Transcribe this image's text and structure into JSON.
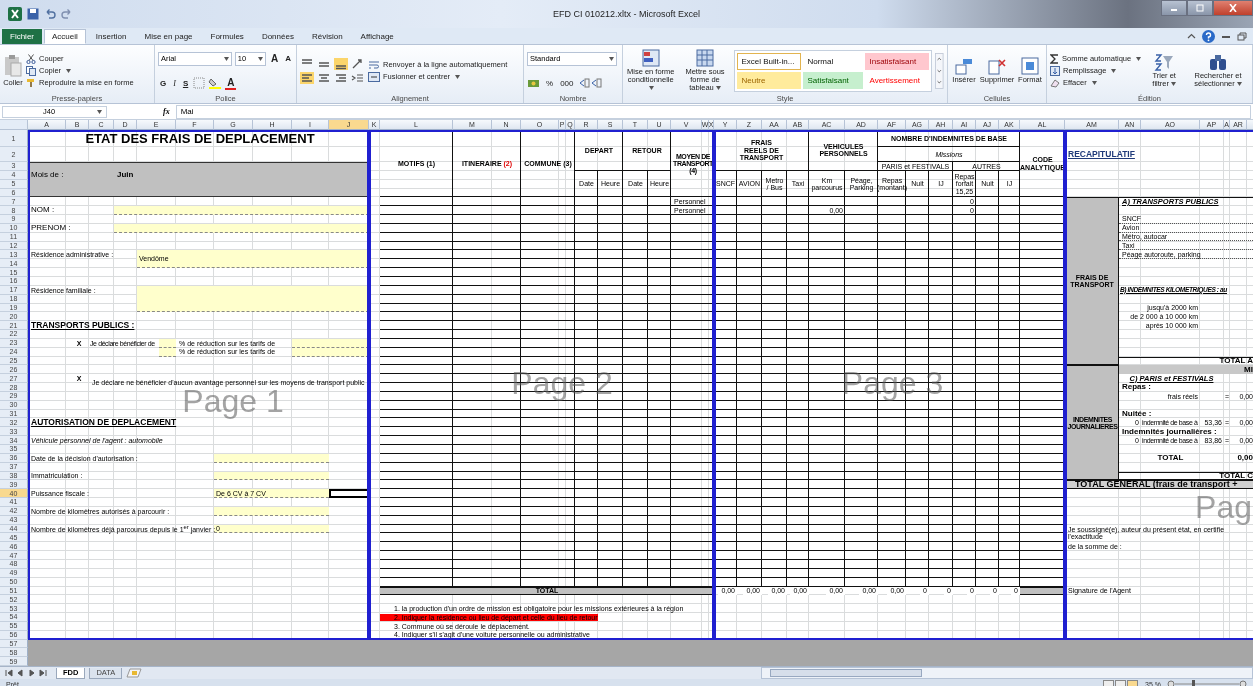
{
  "window": {
    "title": "EFD CI 010212.xltx - Microsoft Excel"
  },
  "tabs": [
    {
      "label": "Fichier",
      "kind": "file",
      "selected": false
    },
    {
      "label": "Accueil",
      "kind": "tab",
      "selected": true
    },
    {
      "label": "Insertion",
      "kind": "tab",
      "selected": false
    },
    {
      "label": "Mise en page",
      "kind": "tab",
      "selected": false
    },
    {
      "label": "Formules",
      "kind": "tab",
      "selected": false
    },
    {
      "label": "Données",
      "kind": "tab",
      "selected": false
    },
    {
      "label": "Révision",
      "kind": "tab",
      "selected": false
    },
    {
      "label": "Affichage",
      "kind": "tab",
      "selected": false
    }
  ],
  "clipboard": {
    "paste": "Coller",
    "cut": "Couper",
    "copy": "Copier",
    "format_painter": "Reproduire la mise en forme",
    "label": "Presse-papiers"
  },
  "font": {
    "family": "Arial",
    "size": "10",
    "grow": "A",
    "shrink": "A",
    "bold": "G",
    "italic": "I",
    "underline": "S",
    "font_color": "A",
    "label": "Police"
  },
  "alignment": {
    "wrap": "Renvoyer à la ligne automatiquement",
    "merge": "Fusionner et centrer",
    "label": "Alignement"
  },
  "number": {
    "format": "Standard",
    "percent": "%",
    "thousands": "000",
    "label": "Nombre"
  },
  "style": {
    "conditional": "Mise en forme conditionnelle",
    "table": "Mettre sous forme de tableau",
    "label": "Style",
    "presets": [
      {
        "label": "Excel Built-in...",
        "kind": "builtin"
      },
      {
        "label": "Normal",
        "kind": "normal"
      },
      {
        "label": "Insatisfaisant",
        "kind": "bad"
      },
      {
        "label": "Neutre",
        "kind": "neutral"
      },
      {
        "label": "Satisfaisant",
        "kind": "good"
      },
      {
        "label": "Avertissement",
        "kind": "warning"
      }
    ]
  },
  "cells": {
    "insert": "Insérer",
    "delete": "Supprimer",
    "format": "Format",
    "label": "Cellules"
  },
  "editing": {
    "autosum": "Somme automatique",
    "fill": "Remplissage",
    "clear": "Effacer",
    "sort": "Trier et filtrer",
    "find": "Rechercher et sélectionner",
    "label": "Édition"
  },
  "formula_bar": {
    "name_box": "J40",
    "function_label": "fx",
    "value": "Mai"
  },
  "columns": [
    {
      "label": "A",
      "selected": false
    },
    {
      "label": "B",
      "selected": false
    },
    {
      "label": "C",
      "selected": false
    },
    {
      "label": "D",
      "selected": false
    },
    {
      "label": "E",
      "selected": false
    },
    {
      "label": "F",
      "selected": false
    },
    {
      "label": "G",
      "selected": false
    },
    {
      "label": "H",
      "selected": false
    },
    {
      "label": "I",
      "selected": false
    },
    {
      "label": "J",
      "selected": true
    },
    {
      "label": "K",
      "selected": false
    },
    {
      "label": "L",
      "selected": false
    },
    {
      "label": "M",
      "selected": false
    },
    {
      "label": "N",
      "selected": false
    },
    {
      "label": "O",
      "selected": false
    },
    {
      "label": "P",
      "selected": false
    },
    {
      "label": "Q",
      "selected": false
    },
    {
      "label": "R",
      "selected": false
    },
    {
      "label": "S",
      "selected": false
    },
    {
      "label": "T",
      "selected": false
    },
    {
      "label": "U",
      "selected": false
    },
    {
      "label": "V",
      "selected": false
    },
    {
      "label": "W",
      "selected": false
    },
    {
      "label": "X",
      "selected": false
    },
    {
      "label": "Y",
      "selected": false
    },
    {
      "label": "Z",
      "selected": false
    },
    {
      "label": "AA",
      "selected": false
    },
    {
      "label": "AB",
      "selected": false
    },
    {
      "label": "AC",
      "selected": false
    },
    {
      "label": "AD",
      "selected": false
    },
    {
      "label": "AF",
      "selected": false
    },
    {
      "label": "AG",
      "selected": false
    },
    {
      "label": "AH",
      "selected": false
    },
    {
      "label": "AI",
      "selected": false
    },
    {
      "label": "AJ",
      "selected": false
    },
    {
      "label": "AK",
      "selected": false
    },
    {
      "label": "AL",
      "selected": false
    },
    {
      "label": "AM",
      "selected": false
    },
    {
      "label": "AN",
      "selected": false
    },
    {
      "label": "AO",
      "selected": false
    },
    {
      "label": "AP",
      "selected": false
    },
    {
      "label": "A",
      "selected": false
    },
    {
      "label": "AR",
      "selected": false
    }
  ],
  "rows": [
    {
      "label": "1",
      "selected": false
    },
    {
      "label": "2",
      "selected": false
    },
    {
      "label": "3",
      "selected": false
    },
    {
      "label": "4",
      "selected": false
    },
    {
      "label": "5",
      "selected": false
    },
    {
      "label": "6",
      "selected": false
    },
    {
      "label": "7",
      "selected": false
    },
    {
      "label": "8",
      "selected": false
    },
    {
      "label": "9",
      "selected": false
    },
    {
      "label": "10",
      "selected": false
    },
    {
      "label": "11",
      "selected": false
    },
    {
      "label": "12",
      "selected": false
    },
    {
      "label": "13",
      "selected": false
    },
    {
      "label": "14",
      "selected": false
    },
    {
      "label": "15",
      "selected": false
    },
    {
      "label": "16",
      "selected": false
    },
    {
      "label": "17",
      "selected": false
    },
    {
      "label": "18",
      "selected": false
    },
    {
      "label": "19",
      "selected": false
    },
    {
      "label": "20",
      "selected": false
    },
    {
      "label": "21",
      "selected": false
    },
    {
      "label": "22",
      "selected": false
    },
    {
      "label": "23",
      "selected": false
    },
    {
      "label": "24",
      "selected": false
    },
    {
      "label": "25",
      "selected": false
    },
    {
      "label": "26",
      "selected": false
    },
    {
      "label": "27",
      "selected": false
    },
    {
      "label": "28",
      "selected": false
    },
    {
      "label": "29",
      "selected": false
    },
    {
      "label": "30",
      "selected": false
    },
    {
      "label": "31",
      "selected": false
    },
    {
      "label": "32",
      "selected": false
    },
    {
      "label": "33",
      "selected": false
    },
    {
      "label": "34",
      "selected": false
    },
    {
      "label": "35",
      "selected": false
    },
    {
      "label": "36",
      "selected": false
    },
    {
      "label": "37",
      "selected": false
    },
    {
      "label": "38",
      "selected": false
    },
    {
      "label": "39",
      "selected": false
    },
    {
      "label": "40",
      "selected": true
    },
    {
      "label": "41",
      "selected": false
    },
    {
      "label": "42",
      "selected": false
    },
    {
      "label": "43",
      "selected": false
    },
    {
      "label": "44",
      "selected": false
    },
    {
      "label": "45",
      "selected": false
    },
    {
      "label": "46",
      "selected": false
    },
    {
      "label": "47",
      "selected": false
    },
    {
      "label": "48",
      "selected": false
    },
    {
      "label": "49",
      "selected": false
    },
    {
      "label": "50",
      "selected": false
    },
    {
      "label": "51",
      "selected": false
    },
    {
      "label": "52",
      "selected": false
    },
    {
      "label": "53",
      "selected": false
    },
    {
      "label": "54",
      "selected": false
    },
    {
      "label": "55",
      "selected": false
    },
    {
      "label": "56",
      "selected": false
    },
    {
      "label": "57",
      "selected": false
    },
    {
      "label": "58",
      "selected": false
    },
    {
      "label": "59",
      "selected": false
    }
  ],
  "page1": {
    "title": "ETAT DES FRAIS DE DEPLACEMENT",
    "month_label": "Mois de :",
    "month": "Juin",
    "name_label": "NOM :",
    "first_name_label": "PRENOM :",
    "admin_residence_label": "Résidence administrative :",
    "admin_residence": "Vendôme",
    "family_residence_label": "Résidence familiale :",
    "transport_heading": "TRANSPORTS PUBLICS :",
    "declarations": [
      {
        "mark": "X",
        "text": "Je déclare bénéficier de"
      },
      {
        "mark": "X",
        "text": "Je déclare ne bénéficier d'aucun avantage personnel sur les moyens de transport public"
      }
    ],
    "reduction_labels": [
      "% de réduction sur les tarifs de",
      "% de réduction sur les tarifs de"
    ],
    "authorization_heading": "AUTORISATION DE DEPLACEMENT",
    "vehicle_note": "Véhicule personnel de l'agent : automobile",
    "authorization_fields": [
      {
        "label": "Date de la décision d'autorisation :"
      },
      {
        "label": "Immatriculation :"
      },
      {
        "label": "Puissance fiscale :",
        "value": "De 6 CV à 7 CV"
      },
      {
        "label": "Nombre de kilomètres autorisés à parcourir :"
      },
      {
        "label": "Nombre de kilomètres déjà parcourus depuis le 1$^{er}$ janvier :",
        "value": "0"
      }
    ]
  },
  "page2": {
    "headers": [
      {
        "label": "MOTIFS",
        "note": "(1)",
        "highlighted": false
      },
      {
        "label": "ITINERAIRE",
        "note": "(2)",
        "highlighted": true
      },
      {
        "label": "COMMUNE",
        "note": "(3)",
        "highlighted": false
      }
    ],
    "departure": {
      "label": "DEPART",
      "date": "Date",
      "time": "Heure"
    },
    "return": {
      "label": "RETOUR",
      "date": "Date",
      "time": "Heure"
    },
    "transport_mode": "MOYEN DE TRANSPORT (4)",
    "rows": [
      {
        "transport": "Personnel"
      },
      {
        "transport": "Personnel"
      }
    ],
    "total_label": "TOTAL",
    "footnotes": [
      {
        "text": "1.  la production d'un ordre de mission est obligatoire pour les missions extérieures à la région",
        "highlighted": false
      },
      {
        "text": "2.  Indiquer la résidence ou lieu de départ et celle du lieu de retour",
        "highlighted": true
      },
      {
        "text": "3.  Commune où se déroule le déplacement.",
        "highlighted": false
      },
      {
        "text": "4.  Indiquer s'il s'agit d'une voiture personnelle ou administrative",
        "highlighted": false
      }
    ]
  },
  "page3": {
    "real_costs": {
      "label": "FRAIS REELS DE TRANSPORT",
      "columns": [
        "SNCF",
        "AVION",
        "Metro / Bus",
        "Taxi"
      ]
    },
    "vehicles": {
      "label": "VEHICULES PERSONNELS",
      "columns": [
        "Km parcourus",
        "Péage, Parking"
      ]
    },
    "allowances": {
      "label": "NOMBRE D'INDEMNITES DE BASE",
      "subtitle": "Missions",
      "groups": [
        {
          "label": "PARIS et FESTIVALS",
          "columns": [
            "Repas (montant)",
            "Nuit",
            "IJ"
          ]
        },
        {
          "label": "AUTRES",
          "columns": [
            "Repas forfait 15,25",
            "Nuit",
            "IJ"
          ]
        }
      ]
    },
    "code_label": "CODE ANALYTIQUE",
    "rows": [
      {
        "lunch_flat": "0"
      },
      {
        "km": "0,00",
        "lunch_flat": "0"
      }
    ],
    "totals": [
      "0,00",
      "0,00",
      "0,00",
      "0,00",
      "0,00",
      "0,00",
      "0,00",
      "0",
      "0",
      "0",
      "0",
      "0"
    ]
  },
  "recap": {
    "title": "RECAPITULATIF",
    "transport_label": "FRAIS DE TRANSPORT",
    "public_heading": "A) TRANSPORTS PUBLICS",
    "public_items": [
      "SNCF",
      "Avion",
      "Métro, autocar",
      "Taxi",
      "Péage autoroute, parking"
    ],
    "km_heading": "B) INDEMNITES KILOMETRIQUES : au",
    "km_brackets": [
      "jusqu'à 2000 km",
      "de 2 000 à 10 000 km",
      "après 10 000 km"
    ],
    "total_a": "TOTAL A",
    "missions_cut": "MI",
    "allowances_label": "INDEMNITES JOURNALIERES",
    "paris_heading": "C) PARIS et FESTIVALS",
    "meals_label": "Repas :",
    "meals": {
      "label": "frais réels",
      "equals": "=",
      "amount": "0,00"
    },
    "night_label": "Nuitée :",
    "night": {
      "count": "0",
      "label": "indemnité de base à",
      "rate": "53,36",
      "equals": "=",
      "amount": "0,00"
    },
    "daily_label": "Indemnités journalières :",
    "daily": {
      "count": "0",
      "label": "indemnité de base à",
      "rate": "83,86",
      "equals": "=",
      "amount": "0,00"
    },
    "total_label": "TOTAL",
    "total": "0,00",
    "total_c": "TOTAL C",
    "grand_total": "TOTAL GENERAL (frais de transport +",
    "certification": [
      "Je soussigné(e), auteur du présent état, en certifie l'exactitude",
      "de la somme de :"
    ],
    "signature": "Signature de l'Agent"
  },
  "page_labels": [
    "Page 1",
    "Page 2",
    "Page 3",
    "Pag"
  ],
  "sheet_tabs": [
    {
      "label": "FDD",
      "selected": true
    },
    {
      "label": "DATA",
      "selected": false
    }
  ],
  "status_bar": {
    "mode": "Prêt",
    "zoom": "35 %"
  }
}
